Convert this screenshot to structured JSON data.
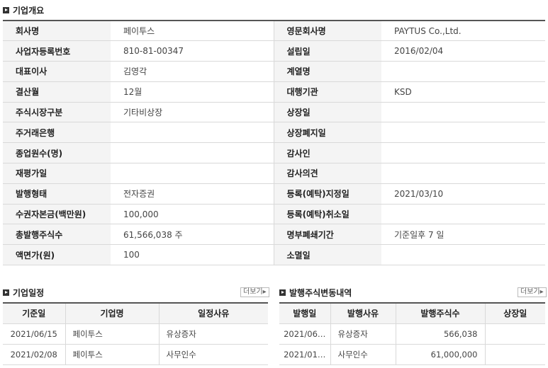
{
  "overview": {
    "title": "기업개요",
    "rows": [
      {
        "l1": "회사명",
        "v1": "페이투스",
        "l2": "영문회사명",
        "v2": "PAYTUS Co.,Ltd."
      },
      {
        "l1": "사업자등록번호",
        "v1": "810-81-00347",
        "l2": "설립일",
        "v2": "2016/02/04"
      },
      {
        "l1": "대표이사",
        "v1": "김영각",
        "l2": "계열명",
        "v2": ""
      },
      {
        "l1": "결산월",
        "v1": "12월",
        "l2": "대행기관",
        "v2": "KSD"
      },
      {
        "l1": "주식시장구분",
        "v1": "기타비상장",
        "l2": "상장일",
        "v2": ""
      },
      {
        "l1": "주거래은행",
        "v1": "",
        "l2": "상장폐지일",
        "v2": ""
      },
      {
        "l1": "종업원수(명)",
        "v1": "",
        "l2": "감사인",
        "v2": ""
      },
      {
        "l1": "재평가일",
        "v1": "",
        "l2": "감사의견",
        "v2": ""
      },
      {
        "l1": "발행형태",
        "v1": "전자증권",
        "l2": "등록(예탁)지정일",
        "v2": "2021/03/10"
      },
      {
        "l1": "수권자본금(백만원)",
        "v1": "100,000",
        "l2": "등록(예탁)취소일",
        "v2": ""
      },
      {
        "l1": "총발행주식수",
        "v1": "61,566,038 주",
        "l2": "명부폐쇄기간",
        "v2": "기준일후 7 일"
      },
      {
        "l1": "액면가(원)",
        "v1": "100",
        "l2": "소멸일",
        "v2": ""
      }
    ]
  },
  "schedule": {
    "title": "기업일정",
    "more_label": "더보기▸",
    "headers": [
      "기준일",
      "기업명",
      "일정사유"
    ],
    "rows": [
      [
        "2021/06/15",
        "페이투스",
        "유상증자"
      ],
      [
        "2021/02/08",
        "페이투스",
        "사무인수"
      ]
    ]
  },
  "issuance": {
    "title": "발행주식변동내역",
    "more_label": "더보기▸",
    "headers": [
      "발행일",
      "발행사유",
      "발행주식수",
      "상장일"
    ],
    "rows": [
      [
        "2021/06…",
        "유상증자",
        "566,038",
        ""
      ],
      [
        "2021/01…",
        "사무인수",
        "61,000,000",
        ""
      ]
    ]
  }
}
